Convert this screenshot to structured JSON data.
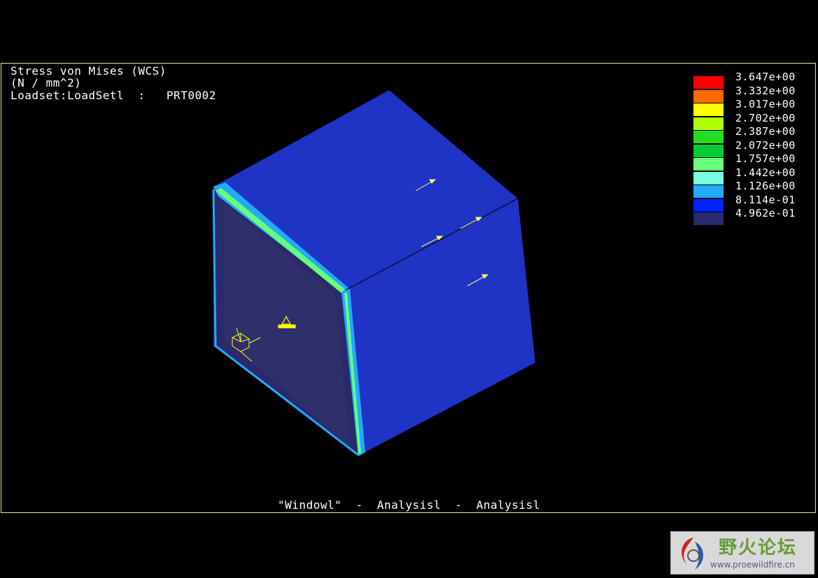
{
  "header": {
    "line1": "Stress von Mises (WCS)",
    "line2": "(N / mm^2)",
    "line3": "Loadset:LoadSetl  :   PRT0002"
  },
  "legend": {
    "entries": [
      {
        "value": "3.647e+00",
        "color": "#ff0000"
      },
      {
        "value": "3.332e+00",
        "color": "#ff6a00"
      },
      {
        "value": "3.017e+00",
        "color": "#ffff00"
      },
      {
        "value": "2.702e+00",
        "color": "#b0ff00"
      },
      {
        "value": "2.387e+00",
        "color": "#22dd22"
      },
      {
        "value": "2.072e+00",
        "color": "#00cc33"
      },
      {
        "value": "1.757e+00",
        "color": "#66ff77"
      },
      {
        "value": "1.442e+00",
        "color": "#77ffdd"
      },
      {
        "value": "1.126e+00",
        "color": "#22aaff"
      },
      {
        "value": "8.114e-01",
        "color": "#0022ff"
      },
      {
        "value": "4.962e-01",
        "color": "#2a2a70"
      }
    ]
  },
  "caption": "\"Windowl\"  -  Analysisl  -  Analysisl",
  "colors": {
    "frame": "#e8e88c",
    "face_main": "#1f33c4",
    "face_left": "#2a2a6a",
    "arrows": "#ffff66",
    "constraints": "#ffff00"
  },
  "watermark": {
    "title": "野火论坛",
    "url": "www.proewildfire.cn"
  }
}
